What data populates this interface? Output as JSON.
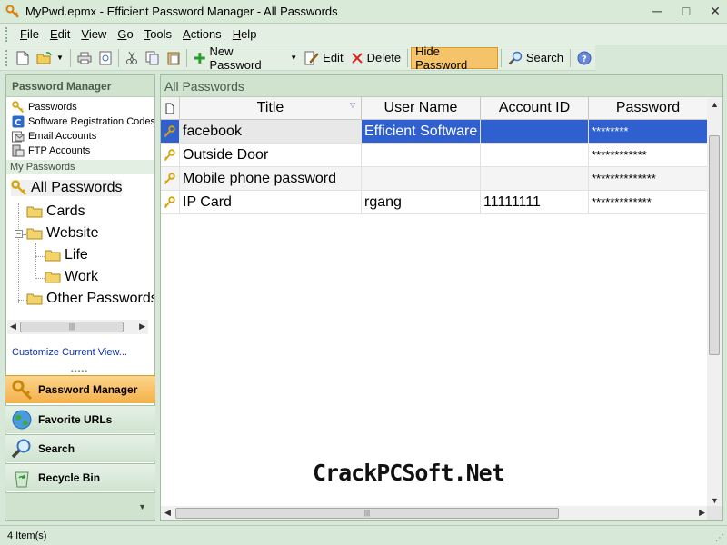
{
  "window": {
    "title": "MyPwd.epmx - Efficient Password Manager - All Passwords"
  },
  "menu": [
    {
      "key": "F",
      "rest": "ile"
    },
    {
      "key": "E",
      "rest": "dit"
    },
    {
      "key": "V",
      "rest": "iew"
    },
    {
      "key": "G",
      "rest": "o"
    },
    {
      "key": "T",
      "rest": "ools"
    },
    {
      "key": "A",
      "rest": "ctions"
    },
    {
      "key": "H",
      "rest": "elp"
    }
  ],
  "toolbar": {
    "new_password": "New Password",
    "edit": "Edit",
    "delete": "Delete",
    "hide_password": "Hide Password",
    "search": "Search"
  },
  "left_panel": {
    "header": "Password Manager",
    "categories": [
      {
        "label": "Passwords",
        "icon": "key-icon"
      },
      {
        "label": "Software Registration Codes",
        "icon": "software-c-icon"
      },
      {
        "label": "Email Accounts",
        "icon": "email-icon"
      },
      {
        "label": "FTP Accounts",
        "icon": "ftp-icon"
      }
    ],
    "my_passwords_label": "My Passwords",
    "tree": {
      "all": "All Passwords",
      "cards": "Cards",
      "website": "Website",
      "life": "Life",
      "work": "Work",
      "other": "Other Passwords"
    },
    "customize": "Customize Current View...",
    "scroll_thumb": "|||",
    "nav": [
      {
        "label": "Password Manager",
        "icon": "key-icon"
      },
      {
        "label": "Favorite URLs",
        "icon": "globe-icon"
      },
      {
        "label": "Search",
        "icon": "magnifier-icon"
      },
      {
        "label": "Recycle Bin",
        "icon": "recycle-icon"
      }
    ]
  },
  "main": {
    "header": "All Passwords",
    "columns": [
      "Title",
      "User Name",
      "Account ID",
      "Password"
    ],
    "rows": [
      {
        "title": "facebook",
        "user": "Efficient Software",
        "account": "",
        "password": "********"
      },
      {
        "title": "Outside Door",
        "user": "",
        "account": "",
        "password": "************"
      },
      {
        "title": "Mobile phone password",
        "user": "",
        "account": "",
        "password": "**************"
      },
      {
        "title": "IP Card",
        "user": "rgang",
        "account": "11111111",
        "password": "*************"
      }
    ],
    "scroll_thumb": "|||"
  },
  "watermark": "CrackPCSoft.Net",
  "status": {
    "items": "4 Item(s)"
  },
  "colors": {
    "accent": "#f4b04a",
    "selection": "#3060d0",
    "chrome": "#d8e8d8"
  }
}
